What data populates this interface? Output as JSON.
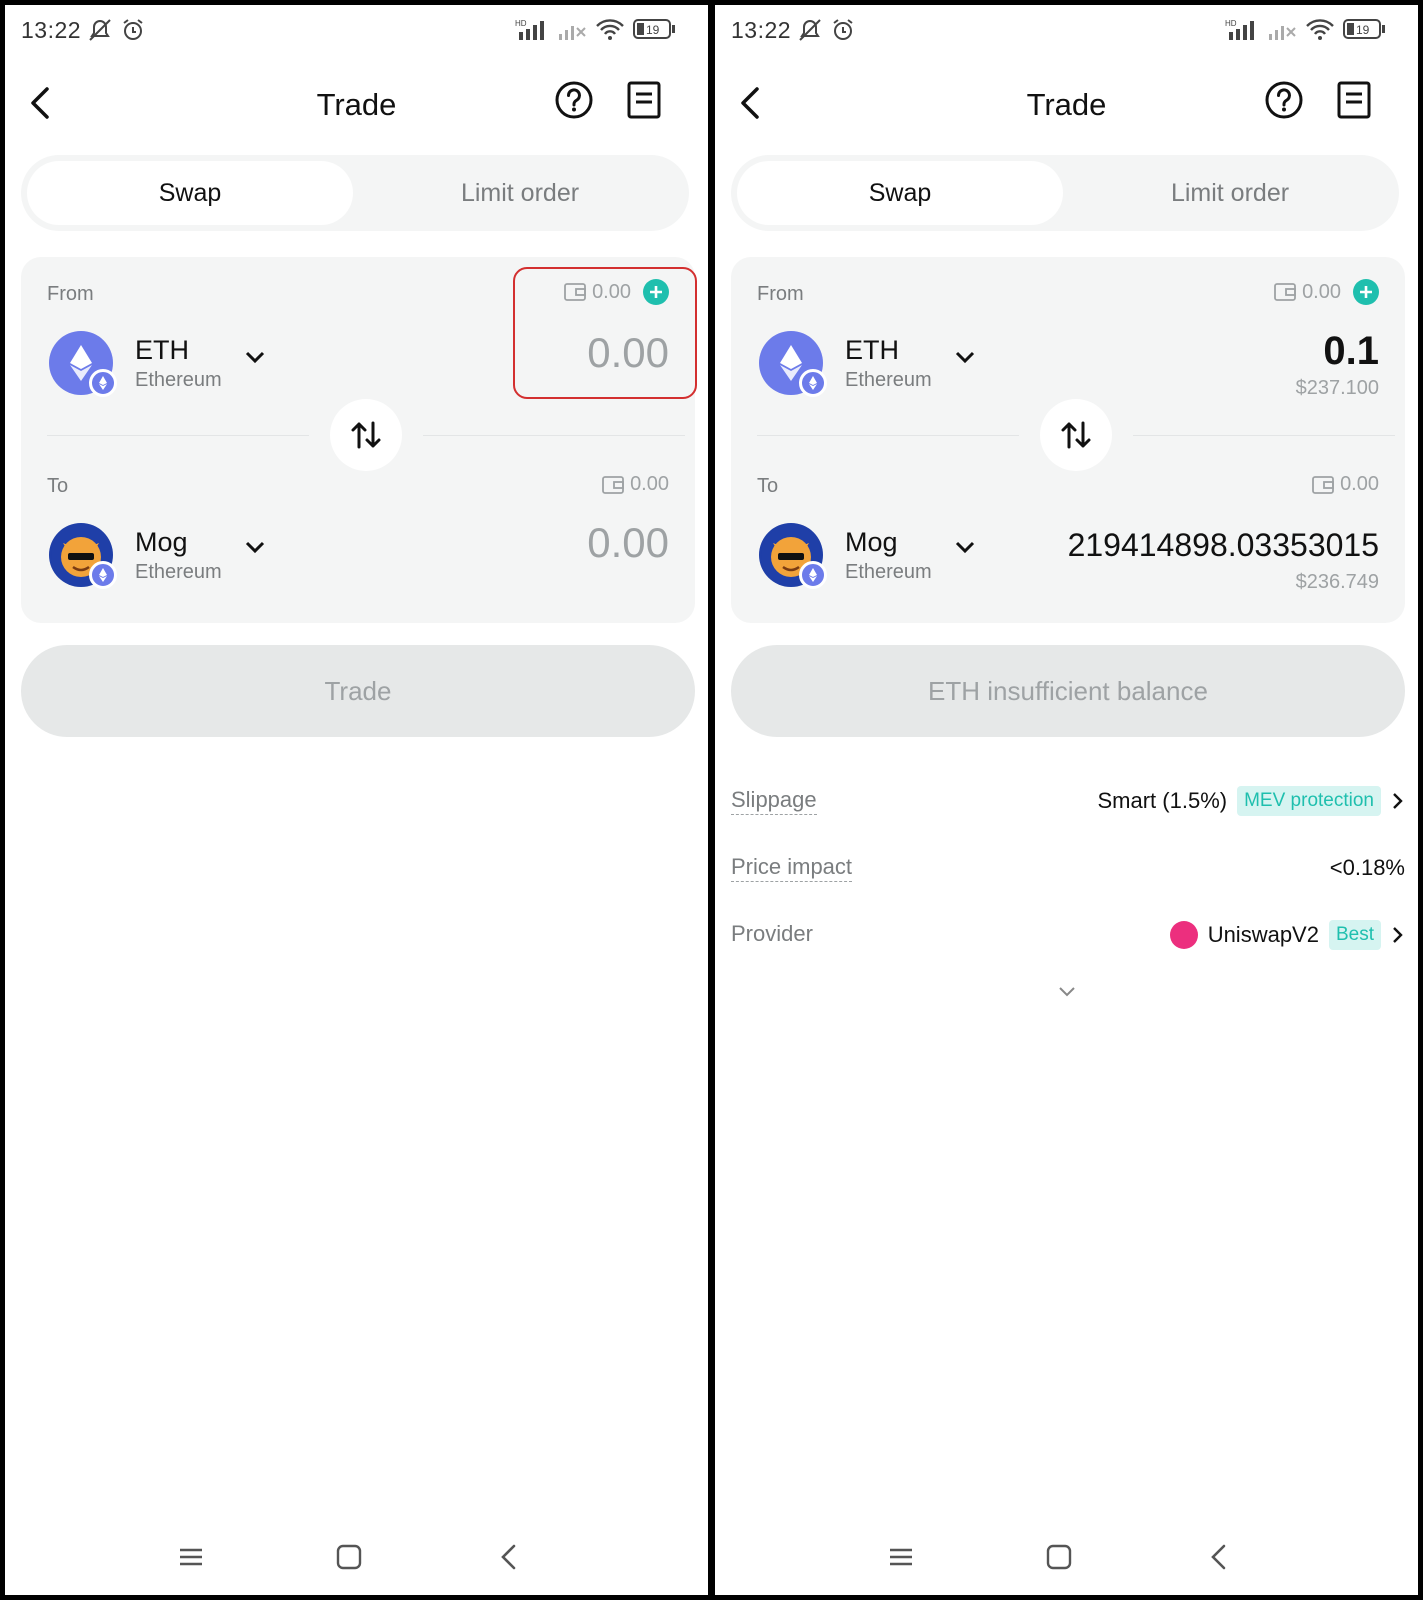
{
  "status_bar": {
    "time": "13:22",
    "battery": "19"
  },
  "header": {
    "title": "Trade"
  },
  "tabs": {
    "swap": "Swap",
    "limit": "Limit order"
  },
  "icons": {
    "back": "back-arrow-icon",
    "help": "help-icon",
    "orders": "order-history-icon",
    "swap_direction": "swap-direction-icon",
    "wallet": "wallet-icon",
    "add": "plus-icon"
  },
  "colors": {
    "accent": "#1fbfae",
    "eth": "#6c7bea",
    "highlight": "#d32f2f",
    "provider": "#ec2f7e"
  },
  "screens": {
    "left": {
      "from": {
        "label": "From",
        "balance": "0.00",
        "symbol": "ETH",
        "chain": "Ethereum",
        "amount": "0.00"
      },
      "to": {
        "label": "To",
        "balance": "0.00",
        "symbol": "Mog",
        "chain": "Ethereum",
        "amount": "0.00"
      },
      "button": "Trade"
    },
    "right": {
      "from": {
        "label": "From",
        "balance": "0.00",
        "symbol": "ETH",
        "chain": "Ethereum",
        "amount": "0.1",
        "usd": "$237.100"
      },
      "to": {
        "label": "To",
        "balance": "0.00",
        "symbol": "Mog",
        "chain": "Ethereum",
        "amount": "219414898.03353015",
        "usd": "$236.749"
      },
      "button": "ETH insufficient balance",
      "details": {
        "slippage_label": "Slippage",
        "slippage_value": "Smart (1.5%)",
        "slippage_tag": "MEV protection",
        "impact_label": "Price impact",
        "impact_value": "<0.18%",
        "provider_label": "Provider",
        "provider_value": "UniswapV2",
        "provider_tag": "Best"
      }
    }
  }
}
